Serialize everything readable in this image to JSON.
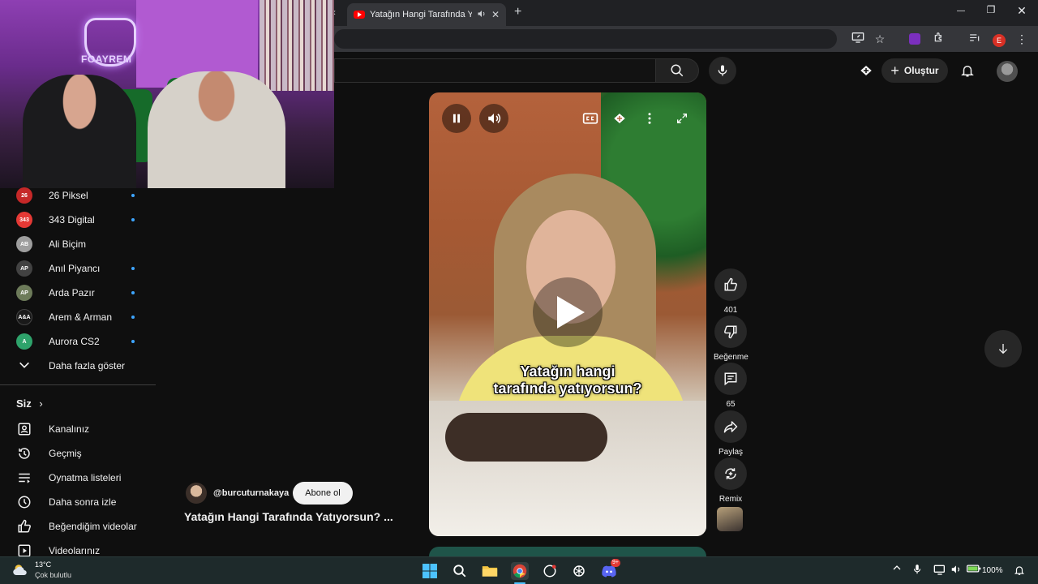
{
  "browser": {
    "tab_title": "Yatağın Hangi Tarafında Yatıyorsun? #shorts",
    "tab_close": "✕",
    "new_tab": "+",
    "back_chevron": "‹",
    "minimize": "—",
    "restore": "❐",
    "close": "✕",
    "profile_initial": "E"
  },
  "header": {
    "create_label": "Oluştur",
    "create_plus": "+"
  },
  "webcam": {
    "logo_text": "FOAYREM"
  },
  "sidebar": {
    "subscriptions": [
      {
        "name": "26 Piksel",
        "avatar_text": "26",
        "color": "#c62828",
        "new": true
      },
      {
        "name": "343 Digital",
        "avatar_text": "343",
        "color": "#e53935",
        "new": true
      },
      {
        "name": "Ali Biçim",
        "avatar_text": "AB",
        "color": "#9e9e9e",
        "new": false
      },
      {
        "name": "Anıl Piyancı",
        "avatar_text": "AP",
        "color": "#424242",
        "new": true
      },
      {
        "name": "Arda Pazır",
        "avatar_text": "AP",
        "color": "#6d7b5a",
        "new": true
      },
      {
        "name": "Arem & Arman",
        "avatar_text": "A&A",
        "color": "#1a1a1a",
        "new": true
      },
      {
        "name": "Aurora CS2",
        "avatar_text": "A",
        "color": "#2ea36b",
        "new": true
      }
    ],
    "show_more": "Daha fazla göster",
    "you_section": "Siz",
    "you_chevron": "›",
    "you_items": [
      {
        "label": "Kanalınız",
        "icon": "channel-icon"
      },
      {
        "label": "Geçmiş",
        "icon": "history-icon"
      },
      {
        "label": "Oynatma listeleri",
        "icon": "playlists-icon"
      },
      {
        "label": "Daha sonra izle",
        "icon": "watch-later-icon"
      },
      {
        "label": "Beğendiğim videolar",
        "icon": "liked-videos-icon"
      },
      {
        "label": "Videolarınız",
        "icon": "your-videos-icon"
      }
    ]
  },
  "video": {
    "caption_line1": "Yatağın hangi",
    "caption_line2": "tarafında yatıyorsun?",
    "channel": "@burcuturnakaya",
    "subscribe": "Abone ol",
    "title": "Yatağın Hangi Tarafında Yatıyorsun? ..."
  },
  "actions": {
    "likes": "401",
    "dislike": "Beğenme",
    "comments": "65",
    "share": "Paylaş",
    "remix": "Remix"
  },
  "taskbar": {
    "temperature": "13°C",
    "weather": "Çok bulutlu",
    "battery": "100%",
    "discord_badge": "9+"
  },
  "colors": {
    "accent_blue": "#3ea6ff",
    "youtube_red": "#ff0000",
    "background": "#0f0f0f"
  }
}
